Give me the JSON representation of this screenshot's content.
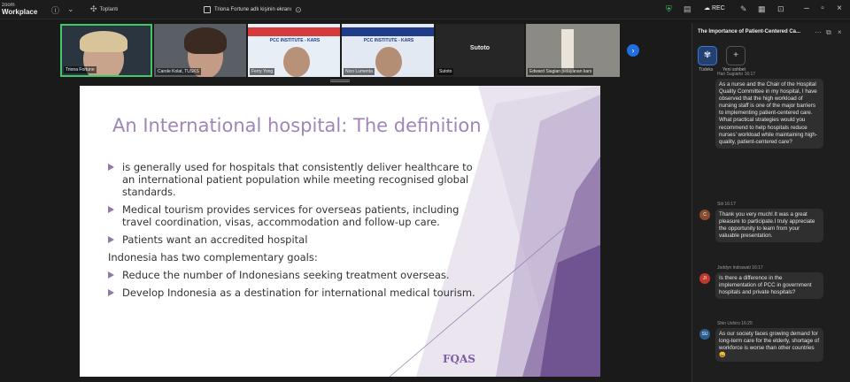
{
  "app": {
    "brand_line1": "zoom",
    "brand_line2": "Workplace"
  },
  "topbar": {
    "apps_label": "Toplantı",
    "share_label": "Triona Fortune adlı kişinin ekranı",
    "rec_label": "REC"
  },
  "gallery": {
    "participants": [
      {
        "name": "Triona Fortune",
        "active": true
      },
      {
        "name": "Carole Kolat, TUSKS",
        "active": false
      },
      {
        "name": "Ferry Yong",
        "active": false
      },
      {
        "name": "Nico Lumenta",
        "active": false
      },
      {
        "name": "Sutoto",
        "active": false
      },
      {
        "name": "Edward Siagian pelayanan kars",
        "active": false
      }
    ],
    "center_label": "Sutoto",
    "strip_label": "PCC INSTITUTE - KARS"
  },
  "slide": {
    "title": "An International hospital: The definition",
    "items": [
      {
        "kind": "bullet",
        "text": "is generally used for hospitals that consistently deliver healthcare to an international patient population while meeting recognised global standards."
      },
      {
        "kind": "bullet",
        "text": "Medical tourism provides services for overseas patients, including travel coordination, visas, accommodation and follow-up care."
      },
      {
        "kind": "bullet",
        "text": "Patients want an accredited hospital"
      },
      {
        "kind": "plain",
        "text": "Indonesia has two complementary goals:"
      },
      {
        "kind": "bullet",
        "text": "Reduce the number of Indonesians seeking treatment overseas."
      },
      {
        "kind": "bullet",
        "text": "Develop Indonesia as a destination for international medical tourism."
      }
    ],
    "logo": "FQAS"
  },
  "chat": {
    "title": "The Importance of Patient-Centered Ca...",
    "apps": [
      {
        "label": "Tüdeks"
      },
      {
        "label": "Yeni sohbet"
      }
    ],
    "messages": [
      {
        "sender": "Hari Sugiarto 16:17",
        "initials": "",
        "avatar_color": "",
        "text": "As a nurse and the Chair of the Hospital Quality Committee in my hospital, I have observed that the high workload of nursing staff is one of the major barriers to implementing patient-centered care. What practical strategies would you recommend to help hospitals reduce nurses' workload while maintaining high-quality, patient-centered care?"
      },
      {
        "sender": "Siti 16:17",
        "initials": "C",
        "avatar_color": "#8a4b2e",
        "text": "Thank you very much!.It was a great pleasure to participate.I truly appreciate the opportunity to learn from your valuable presentation."
      },
      {
        "sender": "Joddyn Indrawati 16:17",
        "initials": "JI",
        "avatar_color": "#c0392b",
        "text": "Is there a difference in the implementation of PCC in government hospitals and private hospitals?"
      },
      {
        "sender": "Shin Ushiro 16:25",
        "initials": "SU",
        "avatar_color": "#2c5d8f",
        "text": "As our society faces growing demand for long-term care for the elderly, shortage of workforce is worse than other countries 😀"
      }
    ]
  }
}
